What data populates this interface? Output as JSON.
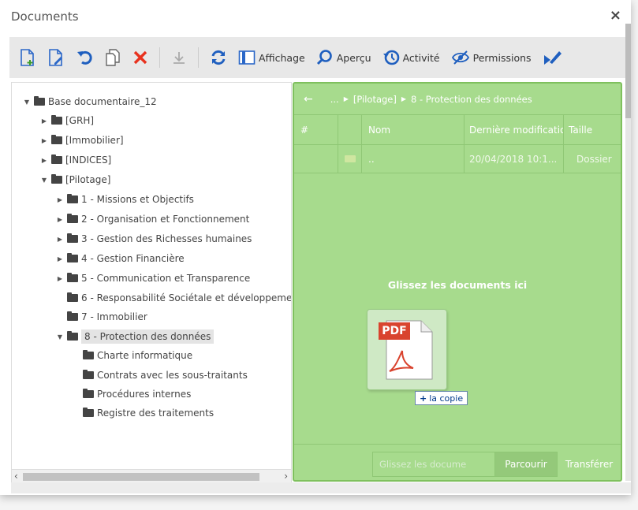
{
  "window": {
    "title": "Documents",
    "close": "×"
  },
  "toolbar": {
    "display_label": "Affichage",
    "preview_label": "Aperçu",
    "activity_label": "Activité",
    "permissions_label": "Permissions"
  },
  "tree": {
    "root": "Base documentaire_12",
    "grh": "[GRH]",
    "immobilier": "[Immobilier]",
    "indices": "[INDICES]",
    "pilotage": "[Pilotage]",
    "p1": "1 - Missions et Objectifs",
    "p2": "2 - Organisation et Fonctionnement",
    "p3": "3 - Gestion des Richesses humaines",
    "p4": "4 - Gestion Financière",
    "p5": "5 - Communication et Transparence",
    "p6": "6 - Responsabilité Sociétale et développement",
    "p7": "7 - Immobilier",
    "p8": "8 - Protection des données",
    "c1": "Charte informatique",
    "c2": "Contrats avec les sous-traitants",
    "c3": "Procédures internes",
    "c4": "Registre des traitements"
  },
  "files": {
    "breadcrumb": {
      "ellipsis": "...",
      "parent": "[Pilotage]",
      "current": "8 - Protection des données"
    },
    "columns": {
      "num": "#",
      "name": "Nom",
      "modified": "Dernière modificatio",
      "size": "Taille"
    },
    "row": {
      "name": "..",
      "modified": "20/04/2018 10:1...",
      "size": "Dossier"
    },
    "drop_text": "Glissez les documents ici",
    "drag": {
      "pdf_label": "PDF",
      "copy_hint": "la copie"
    },
    "footer": {
      "placeholder": "Glissez les docume",
      "browse": "Parcourir",
      "upload": "Transférer"
    }
  },
  "colors": {
    "drop_bg": "#a7db8d",
    "drop_border": "#7fc05e",
    "pdf_red": "#d9432e",
    "delete_red": "#e8321e",
    "toolbar_blue": "#1f5fbf"
  }
}
